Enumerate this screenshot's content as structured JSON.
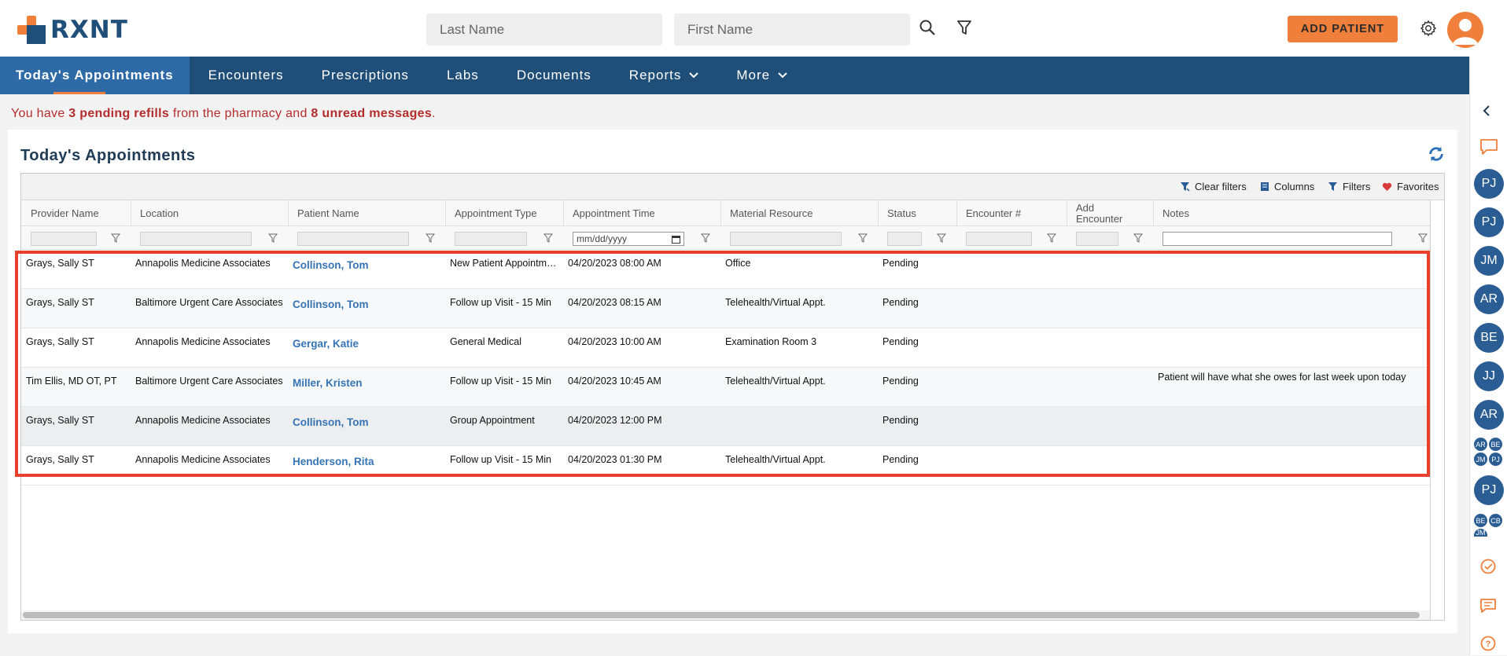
{
  "brand": {
    "name": "RXNT"
  },
  "search": {
    "last_name_placeholder": "Last Name",
    "first_name_placeholder": "First Name"
  },
  "header": {
    "add_patient_label": "ADD PATIENT"
  },
  "nav": {
    "items": [
      {
        "label": "Today's Appointments",
        "active": true
      },
      {
        "label": "Encounters"
      },
      {
        "label": "Prescriptions"
      },
      {
        "label": "Labs"
      },
      {
        "label": "Documents"
      },
      {
        "label": "Reports",
        "caret": true
      },
      {
        "label": "More",
        "caret": true
      }
    ]
  },
  "alert": {
    "prefix": "You have ",
    "refills": "3 pending refills",
    "middle": " from the pharmacy and ",
    "messages": "8 unread messages",
    "suffix": "."
  },
  "panel": {
    "title": "Today's Appointments"
  },
  "toolbar": {
    "clear_filters": "Clear filters",
    "columns": "Columns",
    "filters": "Filters",
    "favorites": "Favorites"
  },
  "grid": {
    "columns": [
      "Provider Name",
      "Location",
      "Patient Name",
      "Appointment Type",
      "Appointment Time",
      "Material Resource",
      "Status",
      "Encounter #",
      "Add Encounter",
      "Notes"
    ],
    "date_filter_placeholder": "mm/dd/yyyy",
    "rows": [
      {
        "provider": "Grays, Sally ST",
        "location": "Annapolis Medicine Associates",
        "patient": "Collinson, Tom",
        "type": "New Patient Appointment",
        "time": "04/20/2023 08:00 AM",
        "resource": "Office",
        "status": "Pending",
        "encounter": "",
        "add": "",
        "notes": ""
      },
      {
        "provider": "Grays, Sally ST",
        "location": "Baltimore Urgent Care Associates",
        "patient": "Collinson, Tom",
        "type": "Follow up Visit - 15 Min",
        "time": "04/20/2023 08:15 AM",
        "resource": "Telehealth/Virtual Appt.",
        "status": "Pending",
        "encounter": "",
        "add": "",
        "notes": ""
      },
      {
        "provider": "Grays, Sally ST",
        "location": "Annapolis Medicine Associates",
        "patient": "Gergar, Katie",
        "type": "General Medical",
        "time": "04/20/2023 10:00 AM",
        "resource": "Examination Room 3",
        "status": "Pending",
        "encounter": "",
        "add": "",
        "notes": ""
      },
      {
        "provider": "Tim Ellis, MD OT, PT",
        "location": "Baltimore Urgent Care Associates",
        "patient": "Miller, Kristen",
        "type": "Follow up Visit - 15 Min",
        "time": "04/20/2023 10:45 AM",
        "resource": "Telehealth/Virtual Appt.",
        "status": "Pending",
        "encounter": "",
        "add": "",
        "notes": "Patient will have what she owes for last week upon today"
      },
      {
        "provider": "Grays, Sally ST",
        "location": "Annapolis Medicine Associates",
        "patient": "Collinson, Tom",
        "type": "Group Appointment",
        "time": "04/20/2023 12:00 PM",
        "resource": "",
        "status": "Pending",
        "encounter": "",
        "add": "",
        "notes": ""
      },
      {
        "provider": "Grays, Sally ST",
        "location": "Annapolis Medicine Associates",
        "patient": "Henderson, Rita",
        "type": "Follow up Visit - 15 Min",
        "time": "04/20/2023 01:30 PM",
        "resource": "Telehealth/Virtual Appt.",
        "status": "Pending",
        "encounter": "",
        "add": "",
        "notes": ""
      }
    ]
  },
  "sidebar": {
    "bubbles": [
      "PJ",
      "PJ",
      "JM",
      "AR",
      "BE",
      "JJ",
      "AR"
    ],
    "group1": [
      "AR",
      "BE",
      "JM",
      "PJ"
    ],
    "bubble_single": "PJ",
    "group2": [
      "BE",
      "CB",
      "JM"
    ]
  },
  "colors": {
    "navy": "#1f4e79",
    "accent": "#ef7f3a",
    "nav_active": "#2e6aa6",
    "alert_red": "#b52c2c",
    "link_blue": "#3674b5",
    "highlight": "#e8402c"
  }
}
